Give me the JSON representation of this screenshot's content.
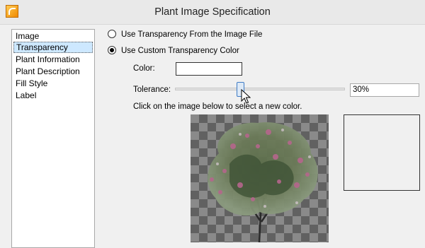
{
  "window": {
    "title": "Plant Image Specification"
  },
  "sidebar": {
    "items": [
      {
        "label": "Image"
      },
      {
        "label": "Transparency"
      },
      {
        "label": "Plant Information"
      },
      {
        "label": "Plant Description"
      },
      {
        "label": "Fill Style"
      },
      {
        "label": "Label"
      }
    ],
    "selected": "Transparency"
  },
  "transparency": {
    "option_file": "Use Transparency From the Image File",
    "option_custom": "Use Custom Transparency Color",
    "selected_option": "Use Custom Transparency Color",
    "color_label": "Color:",
    "color_value": "#ffffff",
    "tolerance_label": "Tolerance:",
    "tolerance_value": "30%",
    "tolerance_fraction": 0.3,
    "instruction": "Click on the image below to select a new color."
  },
  "icons": {
    "app": "app-logo-icon",
    "cursor": "mouse-pointer-icon"
  }
}
